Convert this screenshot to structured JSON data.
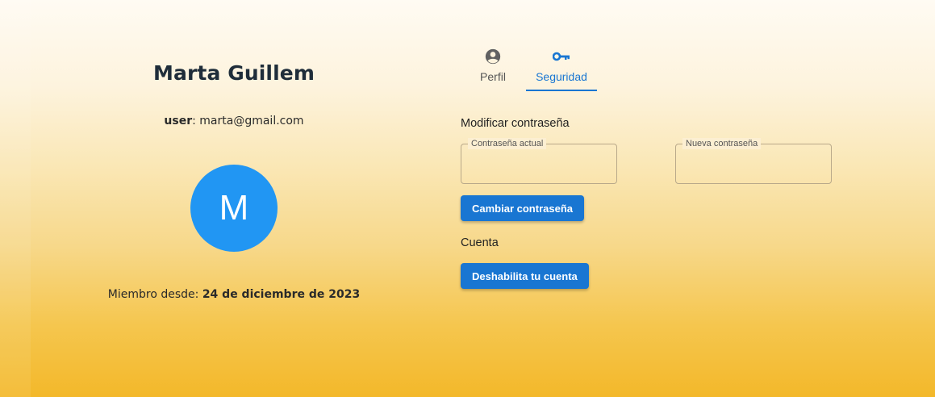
{
  "profile": {
    "name": "Marta Guillem",
    "user_label": "user",
    "email": ": marta@gmail.com",
    "avatar_initial": "M",
    "member_since_label": "Miembro desde: ",
    "member_since_date": "24 de diciembre de 2023"
  },
  "tabs": [
    {
      "label": "Perfil",
      "icon": "account-circle-icon",
      "active": false
    },
    {
      "label": "Seguridad",
      "icon": "key-icon",
      "active": true
    }
  ],
  "security": {
    "change_password_title": "Modificar contraseña",
    "current_password_label": "Contraseña actual",
    "current_password_value": "",
    "new_password_label": "Nueva contraseña",
    "new_password_value": "",
    "change_password_button": "Cambiar contraseña",
    "account_title": "Cuenta",
    "disable_account_button": "Deshabilita tu cuenta"
  },
  "colors": {
    "accent": "#1976d2",
    "avatar": "#2196f3",
    "gradient_top": "#fffbf3",
    "gradient_bottom": "#f3b82a"
  }
}
